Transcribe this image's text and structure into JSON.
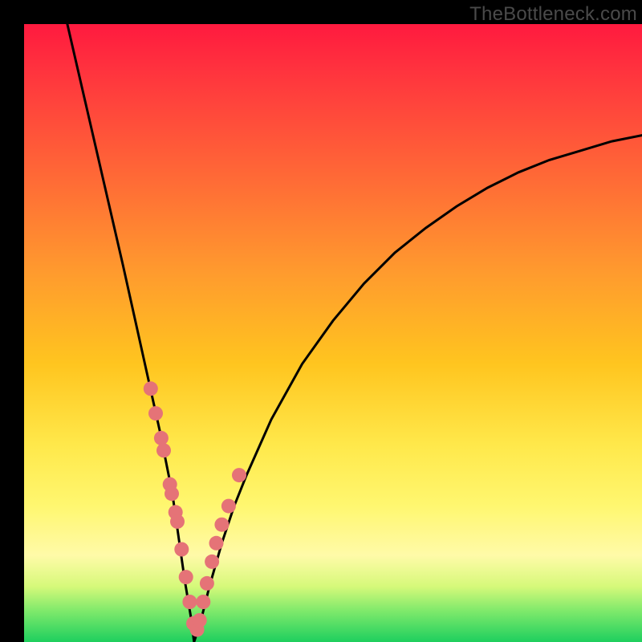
{
  "watermark": "TheBottleneck.com",
  "colors": {
    "curve_stroke": "#000000",
    "dot_fill": "#e57377",
    "background_black": "#000000",
    "gradient_stops": [
      "#ff1a3f",
      "#ff3b3d",
      "#ff6a36",
      "#ff9a2e",
      "#ffc51f",
      "#ffe84a",
      "#fff770",
      "#fffaa8",
      "#d6f97a",
      "#7ee96b",
      "#1ecf5e"
    ]
  },
  "chart_data": {
    "type": "line",
    "title": "",
    "xlabel": "",
    "ylabel": "",
    "xlim": [
      0,
      100
    ],
    "ylim": [
      0,
      100
    ],
    "note": "V-shaped bottleneck curve with minimum near x≈27, y≈0. Left branch is steep; right branch rises with slowly decreasing slope. Axes have no tick labels. Values are estimated from pixel positions.",
    "series": [
      {
        "name": "bottleneck-curve",
        "x": [
          7,
          10,
          13,
          16,
          18,
          20,
          22,
          24,
          25,
          26,
          27,
          27.5,
          28.5,
          30,
          32,
          34,
          36,
          40,
          45,
          50,
          55,
          60,
          65,
          70,
          75,
          80,
          85,
          90,
          95,
          100
        ],
        "y": [
          100,
          87,
          74,
          61,
          52,
          43,
          34,
          24,
          17,
          10,
          4,
          0,
          3,
          9,
          16,
          22,
          27,
          36,
          45,
          52,
          58,
          63,
          67,
          70.5,
          73.5,
          76,
          78,
          79.5,
          81,
          82
        ]
      },
      {
        "name": "sample-dots",
        "x": [
          20.5,
          21.3,
          22.2,
          22.6,
          23.6,
          23.9,
          24.5,
          24.8,
          25.5,
          26.2,
          26.8,
          27.4,
          28.0,
          28.4,
          29.0,
          29.6,
          30.4,
          31.1,
          32.0,
          33.1,
          34.8
        ],
        "y": [
          41.0,
          37.0,
          33.0,
          31.0,
          25.5,
          24.0,
          21.0,
          19.5,
          15.0,
          10.5,
          6.5,
          3.0,
          2.0,
          3.5,
          6.5,
          9.5,
          13.0,
          16.0,
          19.0,
          22.0,
          27.0
        ]
      }
    ]
  }
}
